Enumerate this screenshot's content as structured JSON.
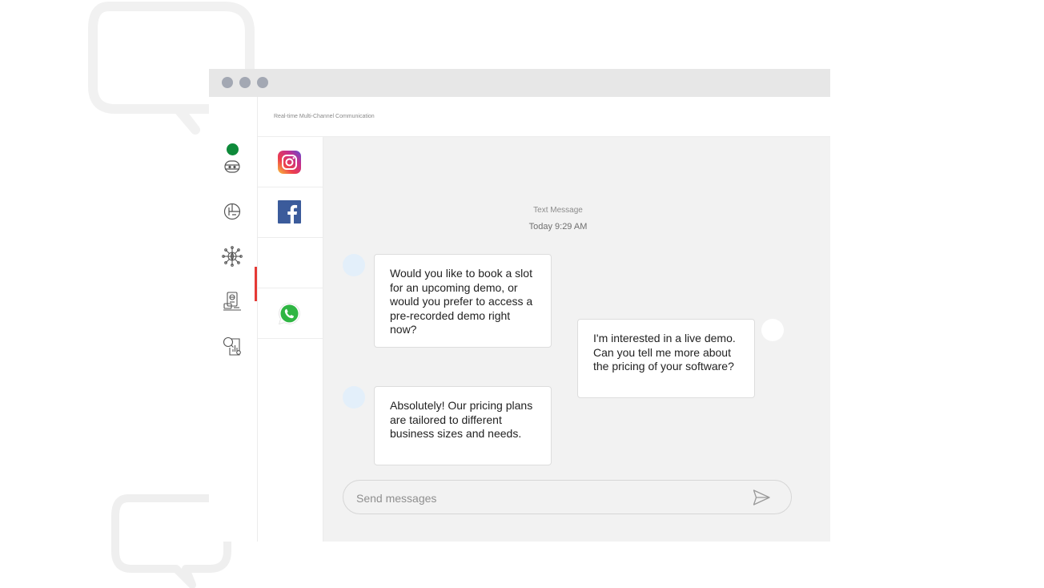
{
  "header": {
    "title": "Real-time Multi-Channel Communication"
  },
  "window": {
    "controls": [
      "dot-icon",
      "dot-icon",
      "dot-icon"
    ]
  },
  "sidebar": {
    "status_color": "#0e8a3a",
    "active_indicator_color": "#e53935",
    "items": [
      {
        "icon": "chatbot-icon"
      },
      {
        "icon": "analytics-icon"
      },
      {
        "icon": "network-icon",
        "active": true
      },
      {
        "icon": "devices-icon"
      },
      {
        "icon": "search-report-icon"
      }
    ]
  },
  "channels": {
    "items": [
      {
        "icon": "instagram-icon"
      },
      {
        "icon": "facebook-icon"
      },
      {
        "icon": "empty"
      },
      {
        "icon": "whatsapp-icon"
      }
    ]
  },
  "chat": {
    "type_label": "Text Message",
    "timestamp": "Today 9:29 AM",
    "messages": [
      {
        "sender": "bot",
        "text": "Would you like to book a slot for an upcoming demo, or would you prefer to access a pre-recorded demo right now?"
      },
      {
        "sender": "user",
        "text": "I'm interested in a live demo. Can you tell me more about the pricing of your software?"
      },
      {
        "sender": "bot",
        "text": "Absolutely! Our pricing plans are tailored to different business sizes and needs."
      }
    ]
  },
  "composer": {
    "placeholder": "Send messages",
    "value": "",
    "send_icon": "send-icon"
  }
}
